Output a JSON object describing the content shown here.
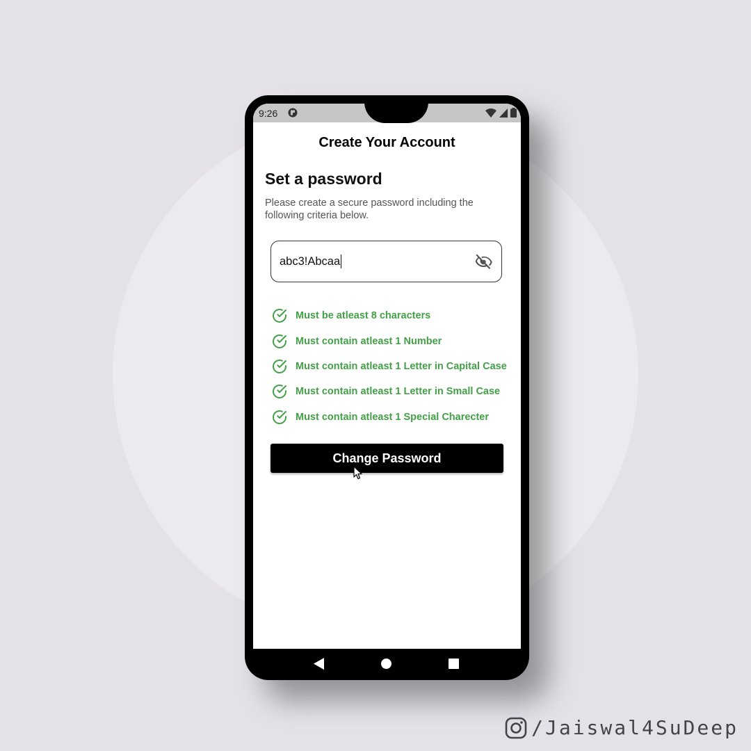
{
  "status_bar": {
    "time": "9:26"
  },
  "screen": {
    "app_title": "Create Your Account",
    "section_title": "Set a password",
    "section_description": "Please create a secure password including the following criteria below.",
    "password_field": {
      "value": "abc3!Abcaa",
      "visibility_icon": "eye-off-icon"
    },
    "criteria": [
      {
        "label": "Must be atleast 8 characters",
        "met": true
      },
      {
        "label": "Must contain atleast 1 Number",
        "met": true
      },
      {
        "label": "Must contain atleast 1 Letter in Capital Case",
        "met": true
      },
      {
        "label": "Must contain atleast 1 Letter in Small Case",
        "met": true
      },
      {
        "label": "Must contain atleast 1 Special Charecter",
        "met": true
      }
    ],
    "primary_button": "Change Password"
  },
  "colors": {
    "criteria_met": "#43a047",
    "button_bg": "#000000",
    "page_bg": "#e4e2e8"
  },
  "watermark": {
    "handle": "/Jaiswal4SuDeep",
    "icon": "instagram-icon"
  }
}
